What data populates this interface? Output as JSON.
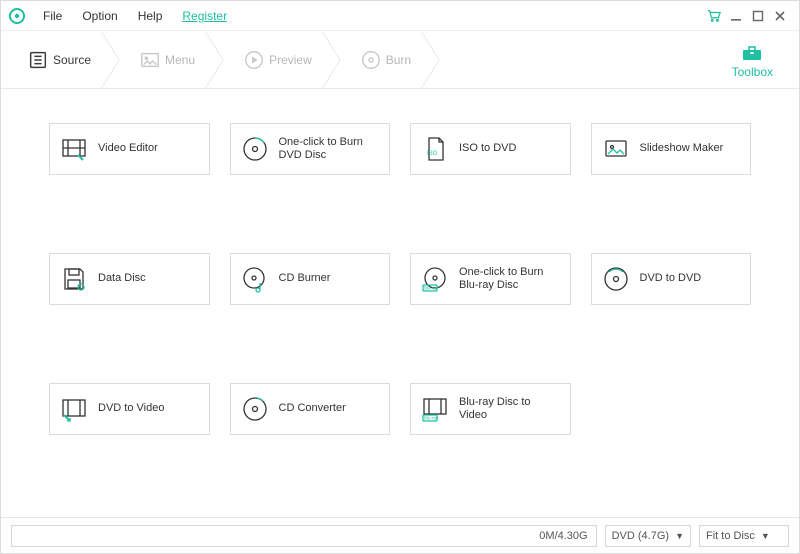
{
  "accent": "#1fbfa2",
  "menubar": {
    "items": [
      {
        "label": "File"
      },
      {
        "label": "Option"
      },
      {
        "label": "Help"
      },
      {
        "label": "Register",
        "highlight": true
      }
    ],
    "window_controls": {
      "cart": "cart-icon",
      "min": "minimize-icon",
      "max": "maximize-icon",
      "close": "close-icon"
    }
  },
  "steps": [
    {
      "key": "source",
      "label": "Source",
      "active": true
    },
    {
      "key": "menu",
      "label": "Menu",
      "active": false
    },
    {
      "key": "preview",
      "label": "Preview",
      "active": false
    },
    {
      "key": "burn",
      "label": "Burn",
      "active": false
    }
  ],
  "toolbox_label": "Toolbox",
  "tools": [
    {
      "key": "video-editor",
      "label": "Video Editor"
    },
    {
      "key": "one-click-dvd",
      "label": "One-click to Burn DVD Disc"
    },
    {
      "key": "iso-to-dvd",
      "label": "ISO to DVD"
    },
    {
      "key": "slideshow-maker",
      "label": "Slideshow Maker"
    },
    {
      "key": "data-disc",
      "label": "Data Disc"
    },
    {
      "key": "cd-burner",
      "label": "CD Burner"
    },
    {
      "key": "one-click-bluray",
      "label": "One-click to Burn Blu-ray Disc"
    },
    {
      "key": "dvd-to-dvd",
      "label": "DVD to DVD"
    },
    {
      "key": "dvd-to-video",
      "label": "DVD to Video"
    },
    {
      "key": "cd-converter",
      "label": "CD Converter"
    },
    {
      "key": "bluray-to-video",
      "label": "Blu-ray Disc to Video"
    }
  ],
  "status": {
    "progress_text": "0M/4.30G",
    "disc_type": "DVD (4.7G)",
    "fit_mode": "Fit to Disc"
  }
}
